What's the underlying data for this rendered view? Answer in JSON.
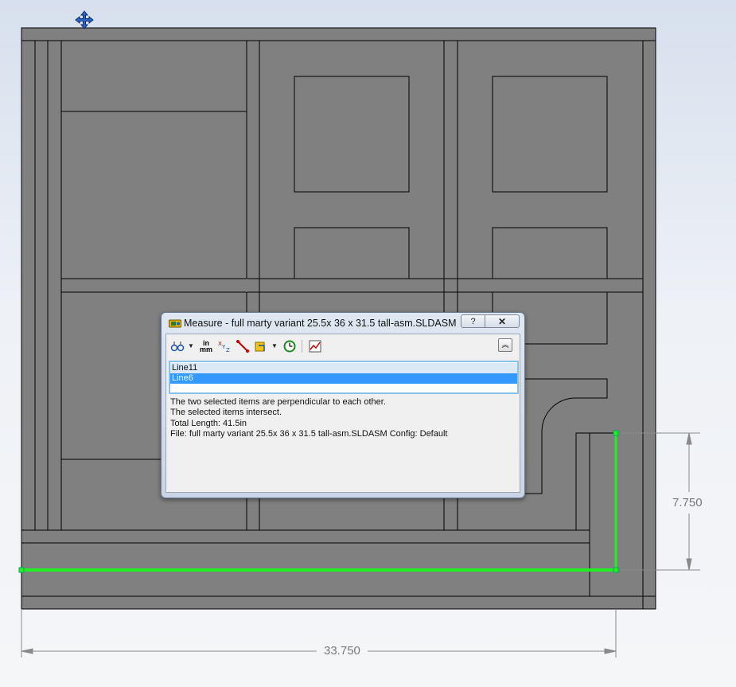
{
  "dimensions": {
    "horizontal": "33.750",
    "vertical": "7.750"
  },
  "colors": {
    "model_face": "#808080",
    "edge": "#000000",
    "highlight": "#22ee22",
    "dimension": "#8a8a8a"
  },
  "cursor": {
    "icon": "move-cursor-icon"
  },
  "dialog": {
    "title": "Measure - full marty variant 25.5x 36 x 31.5 tall-asm.SLDASM",
    "help_label": "?",
    "close_label": "✕",
    "toolbar": {
      "arc_circle": "arc-circle-measurement-icon",
      "units": "in\nmm",
      "units_label_top": "in",
      "units_label_bottom": "mm",
      "xyz": "XYZ",
      "point_to_point": "point-to-point-icon",
      "projection": "projection-icon",
      "history": "measurement-history-icon",
      "sensor": "create-sensor-icon",
      "collapse": "︽"
    },
    "selections": [
      "Line11",
      "Line6"
    ],
    "results": [
      "The two selected items are perpendicular to each other.",
      "The selected items intersect.",
      "Total Length: 41.5in",
      "File: full marty variant 25.5x 36 x 31.5 tall-asm.SLDASM Config: Default"
    ]
  }
}
